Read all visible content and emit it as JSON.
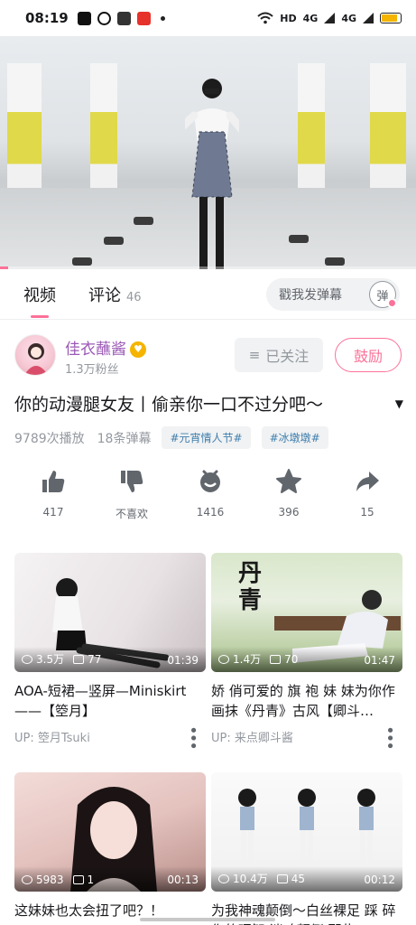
{
  "status_bar": {
    "time": "08:19",
    "network": "HD",
    "signal1": "4G",
    "signal2": "4G",
    "battery_level": 0.85
  },
  "video": {
    "progress": 0.02
  },
  "tabs": {
    "video": "视频",
    "comments": "评论",
    "comments_count": "46",
    "danmaku_placeholder": "戳我发弹幕",
    "danmaku_toggle": "弹"
  },
  "uploader": {
    "name": "佳衣蘸酱",
    "fans": "1.3万粉丝",
    "follow_label": "已关注",
    "encourage_label": "鼓励"
  },
  "video_info": {
    "title": "你的动漫腿女友丨偷亲你一口不过分吧～",
    "plays": "9789次播放",
    "danmaku": "18条弹幕",
    "tags": [
      "#元宵情人节#",
      "#冰墩墩#"
    ]
  },
  "actions": [
    {
      "icon": "thumb-up-icon",
      "label": "417"
    },
    {
      "icon": "thumb-down-icon",
      "label": "不喜欢"
    },
    {
      "icon": "coin-icon",
      "label": "1416"
    },
    {
      "icon": "star-icon",
      "label": "396"
    },
    {
      "icon": "share-icon",
      "label": "15"
    }
  ],
  "related": [
    {
      "views": "3.5万",
      "danmaku": "77",
      "duration": "01:39",
      "title": "AOA-短裙—竖屏—Miniskirt——【箜月】",
      "up": "UP: 箜月Tsuki"
    },
    {
      "views": "1.4万",
      "danmaku": "70",
      "duration": "01:47",
      "title": "娇 俏可爱的 旗 袍 妹 妹为你作画抹《丹青》古风【卿斗…",
      "up": "UP: 来点卿斗酱",
      "thumb_text": "丹青"
    },
    {
      "views": "5983",
      "danmaku": "1",
      "duration": "00:13",
      "title": "这妹妹也太会扭了吧？！",
      "up": ""
    },
    {
      "views": "10.4万",
      "danmaku": "45",
      "duration": "00:12",
      "title": "为我神魂颠倒～白丝裸足 踩 碎你的理智 迷魂颠倒 那些",
      "up": ""
    }
  ],
  "colors": {
    "accent": "#fb7299",
    "uploader_name": "#9b59b6",
    "tag_text": "#3f7fae"
  }
}
